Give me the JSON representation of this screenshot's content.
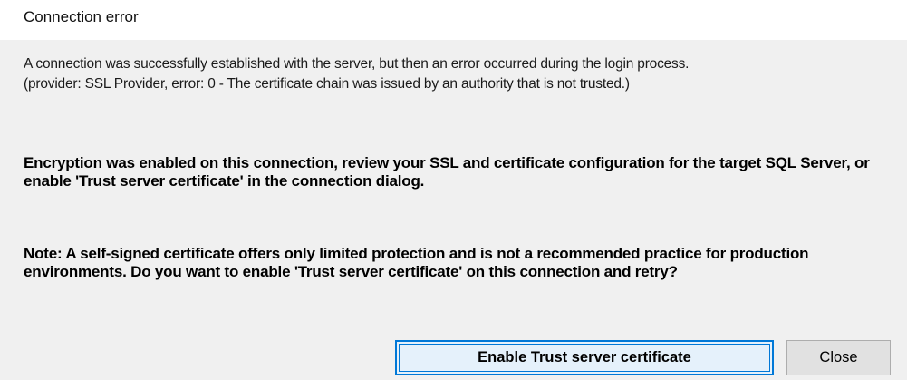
{
  "window": {
    "title": "Connection error"
  },
  "message": {
    "error_line_1": "A connection was successfully established with the server, but then an error occurred during the login process.",
    "error_line_2": "(provider: SSL Provider, error: 0 - The certificate chain was issued by an authority that is not trusted.)",
    "encryption_text": "Encryption was enabled on this connection, review your SSL and certificate configuration for the target SQL Server, or enable 'Trust server certificate' in the connection dialog.",
    "note_text": "Note: A self-signed certificate offers only limited protection and is not a recommended practice for production environments. Do you want to enable 'Trust server certificate' on this connection and retry?"
  },
  "buttons": {
    "enable_trust_label": "Enable Trust server certificate",
    "close_label": "Close"
  },
  "colors": {
    "primary_border": "#0078d7",
    "primary_fill": "#e5f1fb",
    "dialog_background": "#f0f0f0"
  }
}
